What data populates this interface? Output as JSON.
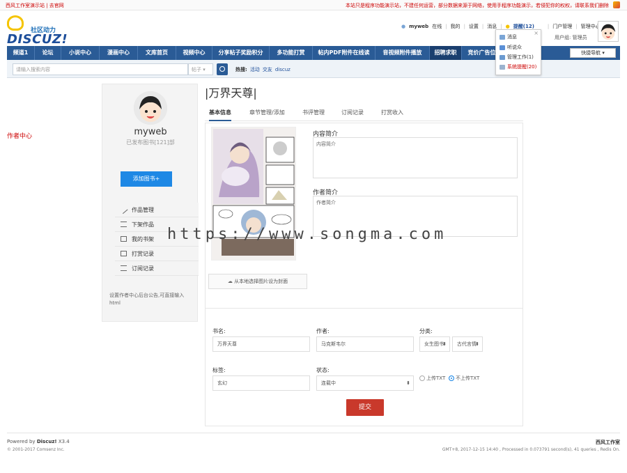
{
  "topbar": {
    "left_text": "西风工作室演示站 | 去官网",
    "right_text": "本站只是程序功能演示站，不建任何运营，部分数据来源于网络，使用手程序功能演示，若侵犯你的权权，请联系我们删除"
  },
  "logo": {
    "subtitle": "社区动力",
    "name": "DISCUZ!"
  },
  "userbar": {
    "username": "myweb",
    "online": "在线",
    "mine": "我的",
    "settings": "设置",
    "messages": "消息",
    "reminders": "提醒(12)",
    "portal_mgmt": "门户管理",
    "admin_center": "管理中心",
    "logout": "退出",
    "group": "用户组: 管理员"
  },
  "dropdown": {
    "items": [
      "消息",
      "听说众",
      "管理工作(1)",
      "系统提醒(20)"
    ]
  },
  "nav": {
    "items": [
      "频道1",
      "论坛",
      "小说中心",
      "漫画中心",
      "文库首页",
      "视频中心",
      "分享帖子奖励积分",
      "多功能打赏",
      "帖内PDF附件在线读",
      "音视频附件播放",
      "招聘求职",
      "竞价广告位"
    ],
    "quick_nav": "快捷导航 ▾"
  },
  "search": {
    "placeholder": "请输入搜索内容",
    "scope": "帖子 ▾",
    "hot_label": "热搜:",
    "hot_items": [
      "活动",
      "交友",
      "discuz"
    ]
  },
  "side": {
    "author_center": "作者中心",
    "username": "myweb",
    "book_count": "已发布图书[121]部",
    "add_book": "添加图书+",
    "menu": [
      "作品管理",
      "下架作品",
      "我的书架",
      "打赏记录",
      "订阅记录"
    ],
    "note": "设置作者中心后台公告,可直接输入html"
  },
  "main": {
    "title": "|万界天尊|",
    "tabs": [
      "基本信息",
      "章节管理/添加",
      "书评管理",
      "订阅记录",
      "打赏收入"
    ],
    "cover_button": "从本地选择图片设为封面",
    "intro_label": "内容简介",
    "intro_value": "内容简介",
    "author_intro_label": "作者简介",
    "author_intro_value": "作者简介",
    "form": {
      "name_label": "书名:",
      "name_value": "万界天尊",
      "author_label": "作者:",
      "author_value": "马克斯韦尔",
      "category_label": "分类:",
      "category_main": "女生图书",
      "category_sub": "古代言情",
      "tags_label": "标签:",
      "tags_value": "玄幻",
      "status_label": "状态:",
      "status_value": "连载中",
      "txt_upload": "上传TXT",
      "txt_noupload": "不上传TXT",
      "submit": "提交"
    }
  },
  "watermark": "https://www.songma.com",
  "footer": {
    "powered": "Powered by",
    "product": "Discuz!",
    "version": "X3.4",
    "copyright": "© 2001-2017 Comsenz Inc.",
    "site": "西风工作室",
    "stats": "GMT+8, 2017-12-15 14:40 , Processed in 0.073791 second(s), 41 queries , Redis On."
  },
  "colors": {
    "nav_bg": "#2a5b96",
    "accent_blue": "#1e88e5",
    "submit_red": "#c9392b",
    "alert_red": "#cc0000"
  }
}
